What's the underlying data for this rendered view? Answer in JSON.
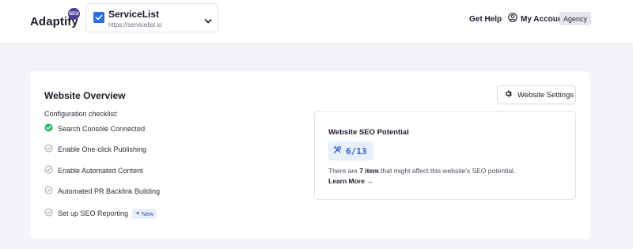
{
  "header": {
    "logo_text": "Adaptify",
    "logo_badge": "SEO",
    "site": {
      "name": "ServiceList",
      "url": "https://servicelist.io"
    },
    "get_help": "Get Help",
    "account": "My Account",
    "agency": "Agency"
  },
  "overview": {
    "title": "Website Overview",
    "settings_button": "Website Settings",
    "checklist_heading": "Configuration checklist:",
    "checklist": [
      {
        "label": "Search Console Connected",
        "done": true
      },
      {
        "label": "Enable One-click Publishing",
        "done": false
      },
      {
        "label": "Enable Automated Content",
        "done": false
      },
      {
        "label": "Automated PR Backlink Building",
        "done": false
      },
      {
        "label": "Set up SEO Reporting",
        "done": false,
        "badge": "New"
      }
    ]
  },
  "seo": {
    "title": "Website SEO Potential",
    "score": "6/13",
    "desc_prefix": "There are ",
    "desc_count": "7 item",
    "desc_suffix": " that might affect this website's SEO potential.",
    "learn_more": "Learn More →"
  },
  "colors": {
    "accent": "#2b6fe0",
    "done_green": "#2eb872",
    "brand_badge": "#4b3f9a"
  }
}
